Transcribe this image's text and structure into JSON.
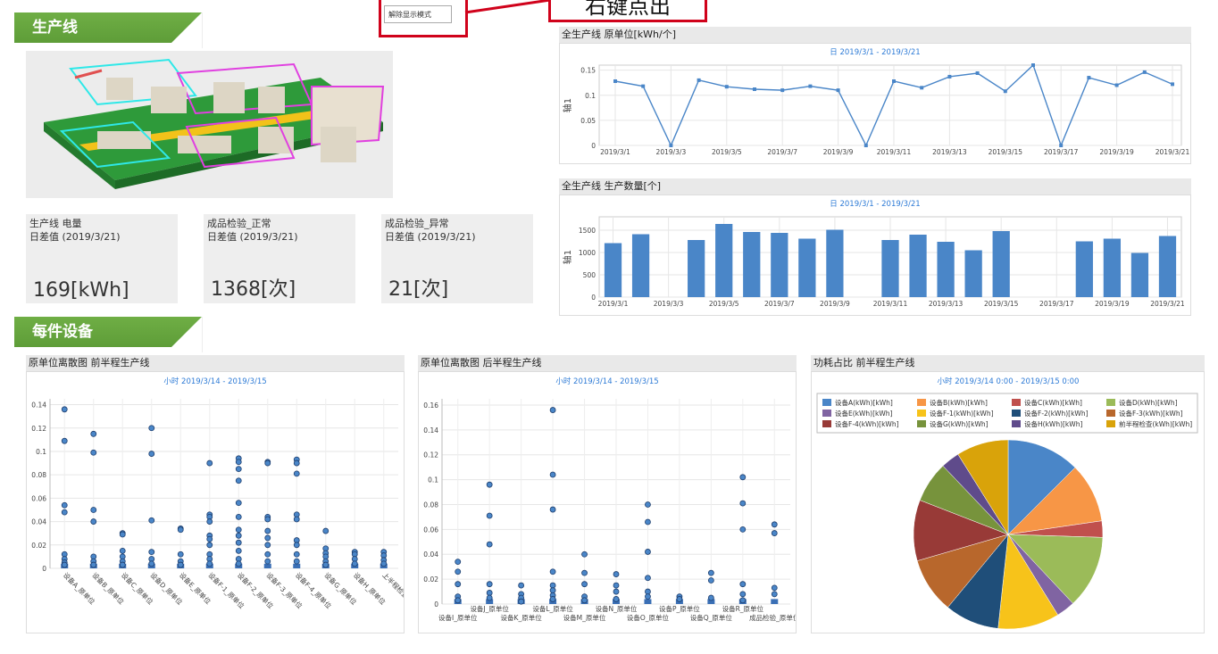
{
  "callout": {
    "text": "右键点出",
    "menu_item": "解除显示模式"
  },
  "sections": {
    "line": "生产线",
    "equipment": "每件设备"
  },
  "kpis": [
    {
      "title": "生产线 电量",
      "subtitle": "日差值 (2019/3/21)",
      "value": "169[kWh]"
    },
    {
      "title": "成品检验_正常",
      "subtitle": "日差值 (2019/3/21)",
      "value": "1368[次]"
    },
    {
      "title": "成品检验_异常",
      "subtitle": "日差值 (2019/3/21)",
      "value": "21[次]"
    }
  ],
  "charts_text": {
    "unit_title": "全生产线 原单位[kWh/个]",
    "unit_sub": "日 2019/3/1 - 2019/3/21",
    "qty_title": "全生产线 生产数量[个]",
    "qty_sub": "日 2019/3/1 - 2019/3/21",
    "axis1": "轴1",
    "s1_title": "原单位离散图 前半程生产线",
    "s1_sub": "小时 2019/3/14 - 2019/3/15",
    "s2_title": "原单位离散图 后半程生产线",
    "s2_sub": "小时 2019/3/14 - 2019/3/15",
    "pie_title": "功耗占比 前半程生产线",
    "pie_sub": "小时 2019/3/14 0:00 - 2019/3/15 0:00"
  },
  "chart_data": [
    {
      "type": "line",
      "title": "全生产线 原单位[kWh/个]",
      "ylabel": "轴1",
      "x": [
        "2019/3/1",
        "2019/3/2",
        "2019/3/3",
        "2019/3/4",
        "2019/3/5",
        "2019/3/6",
        "2019/3/7",
        "2019/3/8",
        "2019/3/9",
        "2019/3/10",
        "2019/3/11",
        "2019/3/12",
        "2019/3/13",
        "2019/3/14",
        "2019/3/15",
        "2019/3/16",
        "2019/3/17",
        "2019/3/18",
        "2019/3/19",
        "2019/3/20",
        "2019/3/21"
      ],
      "xticks": [
        "2019/3/1",
        "2019/3/3",
        "2019/3/5",
        "2019/3/7",
        "2019/3/9",
        "2019/3/11",
        "2019/3/13",
        "2019/3/15",
        "2019/3/17",
        "2019/3/19",
        "2019/3/21"
      ],
      "values": [
        0.128,
        0.118,
        0,
        0.13,
        0.117,
        0.112,
        0.11,
        0.118,
        0.11,
        0,
        0.128,
        0.115,
        0.137,
        0.144,
        0.108,
        0.16,
        0,
        0.135,
        0.12,
        0.146,
        0.122
      ],
      "yticks": [
        "0",
        "0.05",
        "0.1",
        "0.15"
      ],
      "ylim": [
        0,
        0.16
      ],
      "color": "#4a86c8"
    },
    {
      "type": "bar",
      "title": "全生产线 生产数量[个]",
      "ylabel": "轴1",
      "categories": [
        "2019/3/1",
        "2019/3/2",
        "2019/3/3",
        "2019/3/4",
        "2019/3/5",
        "2019/3/6",
        "2019/3/7",
        "2019/3/8",
        "2019/3/9",
        "2019/3/10",
        "2019/3/11",
        "2019/3/12",
        "2019/3/13",
        "2019/3/14",
        "2019/3/15",
        "2019/3/16",
        "2019/3/17",
        "2019/3/18",
        "2019/3/19",
        "2019/3/20",
        "2019/3/21"
      ],
      "xticks": [
        "2019/3/1",
        "2019/3/3",
        "2019/3/5",
        "2019/3/7",
        "2019/3/9",
        "2019/3/11",
        "2019/3/13",
        "2019/3/15",
        "2019/3/17",
        "2019/3/19",
        "2019/3/21"
      ],
      "values": [
        1210,
        1410,
        0,
        1280,
        1640,
        1460,
        1440,
        1310,
        1510,
        0,
        1280,
        1400,
        1240,
        1050,
        1480,
        0,
        0,
        1250,
        1310,
        990,
        1370
      ],
      "yticks": [
        "0",
        "500",
        "1000",
        "1500"
      ],
      "ylim": [
        0,
        1800
      ],
      "color": "#4a86c8"
    },
    {
      "type": "scatter",
      "title": "原单位离散图 前半程生产线",
      "categories": [
        "设备A_原单位",
        "设备B_原单位",
        "设备C_原单位",
        "设备D_原单位",
        "设备E_原单位",
        "设备F-1_原单位",
        "设备F-2_原单位",
        "设备F-3_原单位",
        "设备F-4_原单位",
        "设备G_原单位",
        "设备H_原单位",
        "上半程检查_原单位"
      ],
      "points": [
        [
          0.136,
          0.109,
          0.054,
          0.048,
          0.012,
          0.008,
          0.005,
          0.003
        ],
        [
          0.115,
          0.099,
          0.05,
          0.04,
          0.01,
          0.006,
          0.003
        ],
        [
          0.03,
          0.029,
          0.015,
          0.01,
          0.006,
          0.003
        ],
        [
          0.12,
          0.098,
          0.041,
          0.014,
          0.008,
          0.004
        ],
        [
          0.034,
          0.033,
          0.012,
          0.006,
          0.003
        ],
        [
          0.09,
          0.046,
          0.044,
          0.04,
          0.028,
          0.025,
          0.02,
          0.012,
          0.008,
          0.004
        ],
        [
          0.094,
          0.091,
          0.085,
          0.075,
          0.056,
          0.044,
          0.033,
          0.028,
          0.022,
          0.015,
          0.008,
          0.004
        ],
        [
          0.091,
          0.09,
          0.044,
          0.042,
          0.032,
          0.026,
          0.02,
          0.012,
          0.006
        ],
        [
          0.093,
          0.09,
          0.081,
          0.046,
          0.042,
          0.024,
          0.02,
          0.012,
          0.006
        ],
        [
          0.032,
          0.017,
          0.013,
          0.01,
          0.006,
          0.003
        ],
        [
          0.014,
          0.012,
          0.008,
          0.004
        ],
        [
          0.014,
          0.011,
          0.007,
          0.004
        ]
      ],
      "yticks": [
        "0",
        "0.02",
        "0.04",
        "0.06",
        "0.08",
        "0.1",
        "0.12",
        "0.14"
      ],
      "ylim": [
        0,
        0.145
      ]
    },
    {
      "type": "scatter",
      "title": "原单位离散图 后半程生产线",
      "categories": [
        "设备I_原单位",
        "设备J_原单位",
        "设备K_原单位",
        "设备L_原单位",
        "设备M_原单位",
        "设备N_原单位",
        "设备O_原单位",
        "设备P_原单位",
        "设备Q_原单位",
        "设备R_原单位",
        "成品检验_原单位"
      ],
      "points": [
        [
          0.034,
          0.026,
          0.016,
          0.006,
          0.003
        ],
        [
          0.096,
          0.071,
          0.048,
          0.016,
          0.009,
          0.005
        ],
        [
          0.015,
          0.008,
          0.005,
          0.002
        ],
        [
          0.156,
          0.104,
          0.076,
          0.026,
          0.015,
          0.011,
          0.007,
          0.004
        ],
        [
          0.04,
          0.025,
          0.016,
          0.006,
          0.003
        ],
        [
          0.024,
          0.015,
          0.01,
          0.004
        ],
        [
          0.08,
          0.066,
          0.042,
          0.021,
          0.01,
          0.006
        ],
        [
          0.006,
          0.004
        ],
        [
          0.025,
          0.019,
          0.005
        ],
        [
          0.102,
          0.081,
          0.06,
          0.016,
          0.008,
          0.003
        ],
        [
          0.064,
          0.057,
          0.013,
          0.008
        ]
      ],
      "yticks": [
        "0",
        "0.02",
        "0.04",
        "0.06",
        "0.08",
        "0.1",
        "0.12",
        "0.14",
        "0.16"
      ],
      "ylim": [
        0,
        0.165
      ]
    },
    {
      "type": "pie",
      "title": "功耗占比 前半程生产线",
      "labels": [
        "设备A(kWh)[kWh]",
        "设备B(kWh)[kWh]",
        "设备C(kWh)[kWh]",
        "设备D(kWh)[kWh]",
        "设备E(kWh)[kWh]",
        "设备F-1(kWh)[kWh]",
        "设备F-2(kWh)[kWh]",
        "设备F-3(kWh)[kWh]",
        "设备F-4(kWh)[kWh]",
        "设备G(kWh)[kWh]",
        "设备H(kWh)[kWh]",
        "前半程检查(kWh)[kWh]"
      ],
      "values": [
        12.5,
        10.2,
        2.8,
        12.5,
        3.2,
        10.5,
        9.3,
        9.5,
        10.4,
        7.0,
        3.2,
        8.9
      ],
      "colors": [
        "#4a86c8",
        "#f79646",
        "#c0504d",
        "#9bbb59",
        "#8064a2",
        "#f7c31a",
        "#1f4e79",
        "#b8672c",
        "#983a37",
        "#77933c",
        "#5f4b8b",
        "#d9a30a"
      ]
    }
  ]
}
